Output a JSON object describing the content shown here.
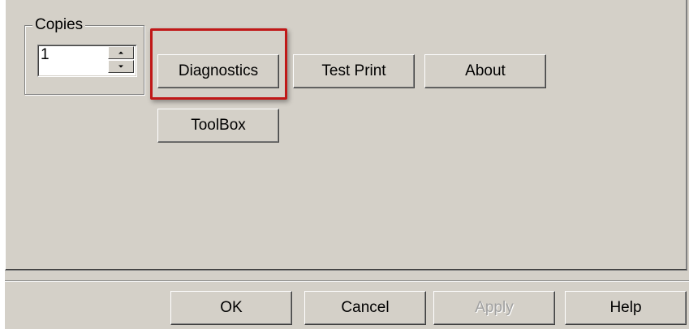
{
  "copies_group": {
    "label": "Copies",
    "value": "1"
  },
  "buttons": {
    "diagnostics": "Diagnostics",
    "test_print": "Test Print",
    "about": "About",
    "toolbox": "ToolBox"
  },
  "footer": {
    "ok": "OK",
    "cancel": "Cancel",
    "apply": "Apply",
    "help": "Help"
  },
  "highlight": {
    "target": "diagnostics",
    "color": "#c01818"
  },
  "colors": {
    "face": "#d4d0c8",
    "disabled_text": "#a0a0a0"
  }
}
